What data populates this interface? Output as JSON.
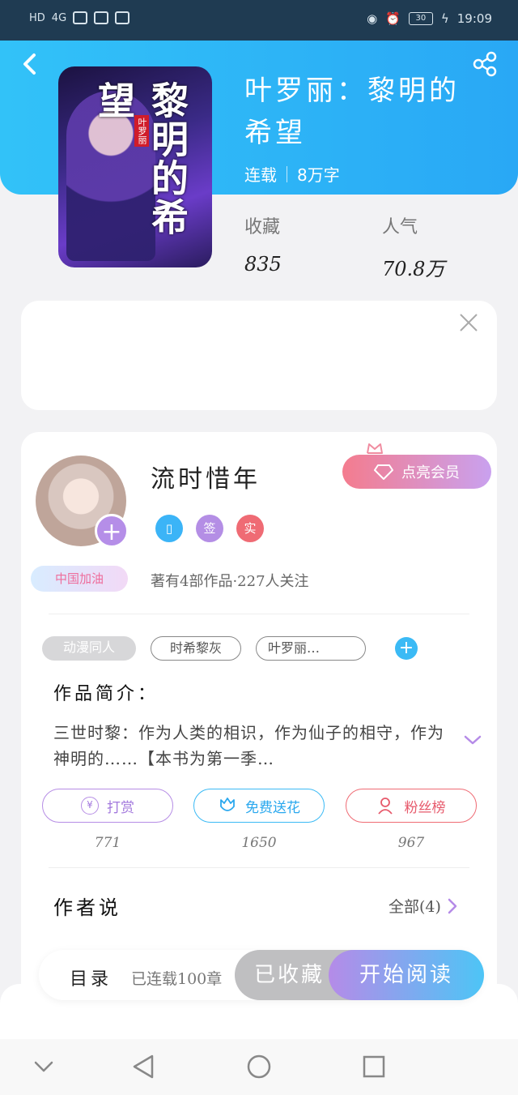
{
  "status_bar": {
    "left_icons": [
      "HD",
      "4G"
    ],
    "battery": "30",
    "time": "19:09"
  },
  "book": {
    "title": "叶罗丽：黎明的希望",
    "status": "连载",
    "word_count": "8万字",
    "cover_title": "黎明的希望",
    "cover_author": "叶罗丽",
    "stats": [
      {
        "label": "收藏",
        "value": "835"
      },
      {
        "label": "人气",
        "value": "70.8万"
      }
    ]
  },
  "author": {
    "name": "流时惜年",
    "vip_button": "点亮会员",
    "badges": [
      "签",
      "实"
    ],
    "fan_tag": "中国加油",
    "stats": "著有4部作品·227人关注"
  },
  "tags": [
    "动漫同人",
    "时希黎灰",
    "叶罗丽…"
  ],
  "intro": {
    "title": "作品简介：",
    "text": "三世时黎：作为人类的相识，作为仙子的相守，作为神明的……【本书为第一季…"
  },
  "actions": [
    {
      "label": "打赏",
      "count": "771"
    },
    {
      "label": "免费送花",
      "count": "1650"
    },
    {
      "label": "粉丝榜",
      "count": "967"
    }
  ],
  "author_says": {
    "title": "作者说",
    "all_link": "全部(4)"
  },
  "bottom_bar": {
    "toc": "目录",
    "serial": "已连载100章",
    "collected": "已收藏",
    "read": "开始阅读"
  },
  "colors": {
    "header_blue": "#2fb6f7",
    "purple": "#b58be8",
    "pink": "#ef6b74"
  }
}
